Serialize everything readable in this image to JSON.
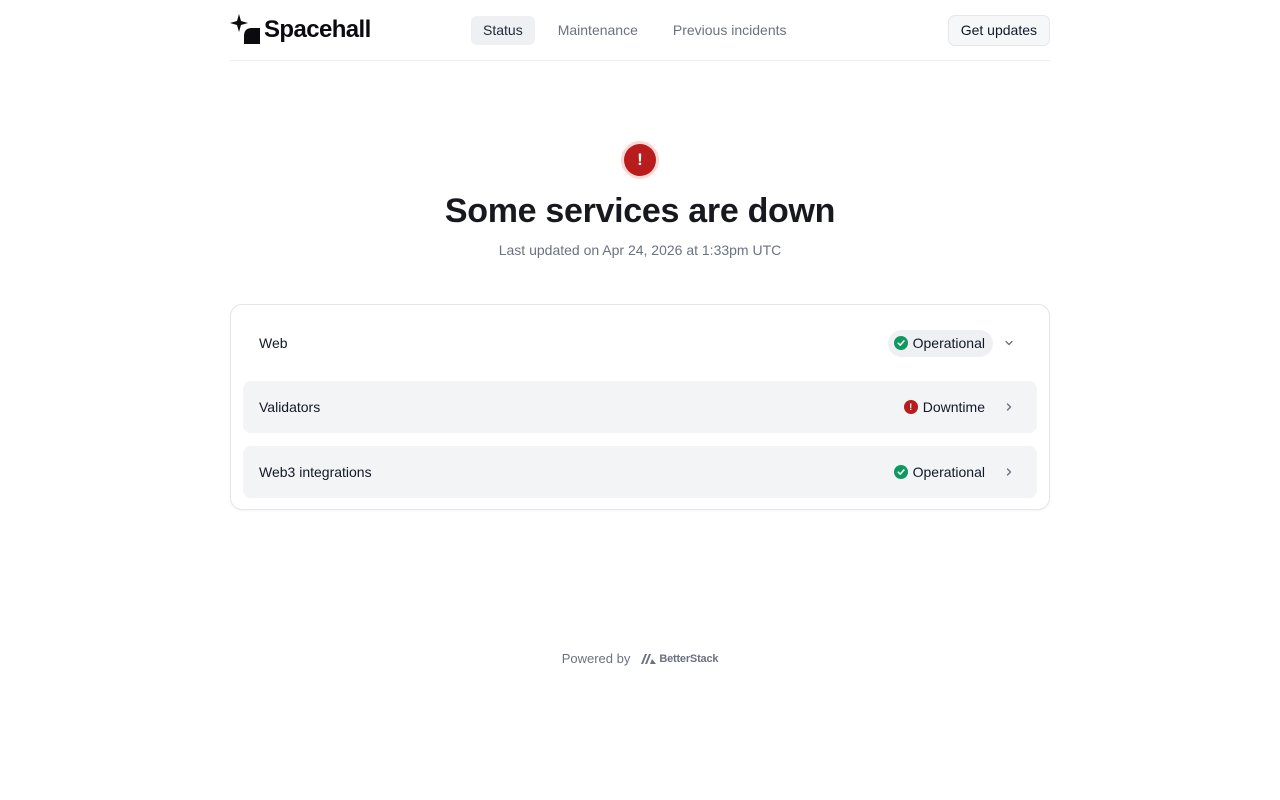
{
  "header": {
    "logo_text": "Spacehall",
    "nav": [
      {
        "label": "Status",
        "active": true
      },
      {
        "label": "Maintenance",
        "active": false
      },
      {
        "label": "Previous incidents",
        "active": false
      }
    ],
    "cta_label": "Get updates"
  },
  "hero": {
    "icon": "exclamation-icon",
    "icon_glyph": "!",
    "title": "Some services are down",
    "subtitle": "Last updated on Apr 24, 2026 at 1:33pm UTC"
  },
  "services": [
    {
      "name": "Web",
      "status": "Operational",
      "status_kind": "operational",
      "chevron": "chevron-down-icon"
    },
    {
      "name": "Validators",
      "status": "Downtime",
      "status_kind": "downtime",
      "chevron": "chevron-right-icon"
    },
    {
      "name": "Web3 integrations",
      "status": "Operational",
      "status_kind": "operational",
      "chevron": "chevron-right-icon"
    }
  ],
  "footer": {
    "powered_by": "Powered by",
    "brand": "BetterStack"
  },
  "colors": {
    "operational": "#0f9960",
    "downtime": "#b91c1c",
    "accent_bg": "#eff0f3"
  }
}
